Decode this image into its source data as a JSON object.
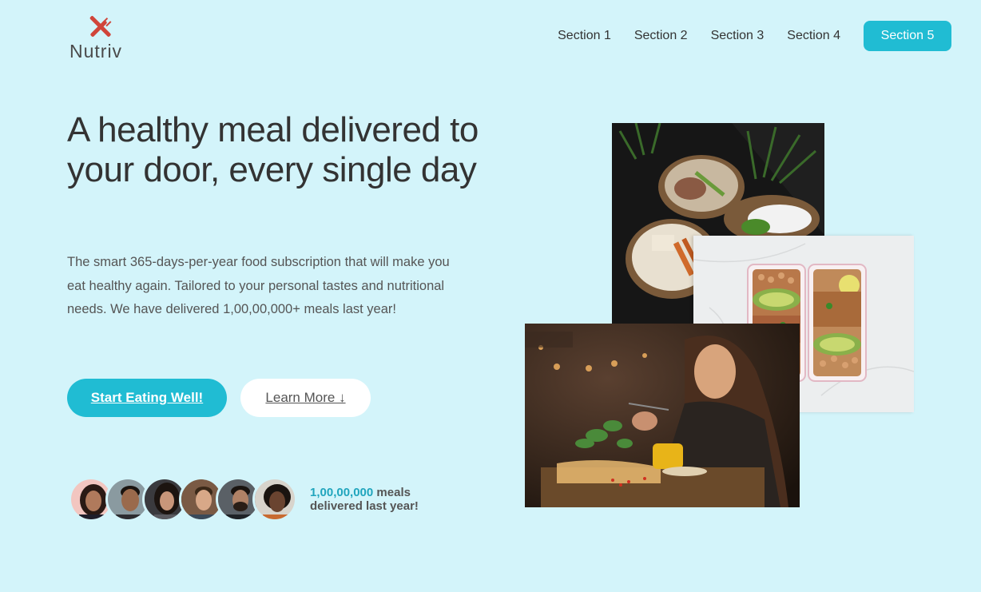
{
  "brand": {
    "name": "Nutriv"
  },
  "nav": {
    "items": [
      "Section 1",
      "Section 2",
      "Section 3",
      "Section 4"
    ],
    "cta": "Section 5"
  },
  "hero": {
    "headline": "A healthy meal delivered to your door, every single day",
    "description": "The smart 365-days-per-year food subscription that will make you eat healthy again. Tailored to your personal tastes and nutritional needs. We have delivered 1,00,00,000+ meals last year!",
    "primary_button": "Start Eating Well!",
    "secondary_button": "Learn More ↓"
  },
  "social_proof": {
    "count": "1,00,00,000",
    "suffix_line1": " meals",
    "line2": "delivered last year!"
  },
  "colors": {
    "background": "#d3f4fa",
    "accent": "#20bcd3",
    "logo_icon": "#d0453a"
  },
  "icons": {
    "logo": "fork-knife-cross-icon",
    "arrow": "down-arrow"
  }
}
